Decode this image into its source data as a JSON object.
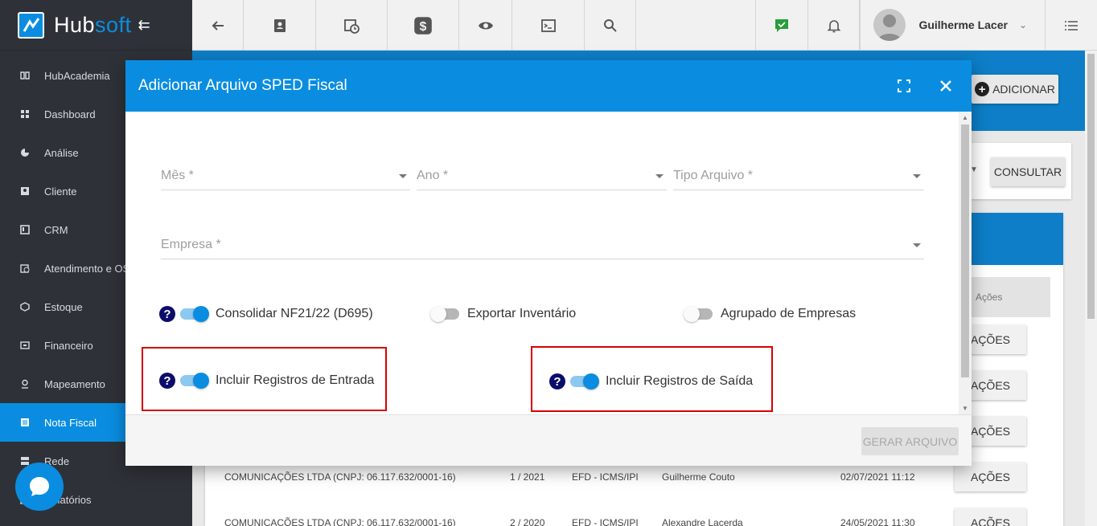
{
  "brand": {
    "name_a": "Hub",
    "name_b": "soft",
    "collapse_glyph": "⇇"
  },
  "sidebar": {
    "items": [
      {
        "label": "HubAcademia",
        "icon": "book-icon"
      },
      {
        "label": "Dashboard",
        "icon": "grid-icon"
      },
      {
        "label": "Análise",
        "icon": "pie-chart-icon"
      },
      {
        "label": "Cliente",
        "icon": "id-card-icon"
      },
      {
        "label": "CRM",
        "icon": "board-icon"
      },
      {
        "label": "Atendimento e OS",
        "icon": "clock-calendar-icon"
      },
      {
        "label": "Estoque",
        "icon": "box-icon"
      },
      {
        "label": "Financeiro",
        "icon": "money-icon"
      },
      {
        "label": "Mapeamento",
        "icon": "map-pin-icon"
      },
      {
        "label": "Nota Fiscal",
        "icon": "document-icon"
      },
      {
        "label": "Rede",
        "icon": "network-icon"
      },
      {
        "label": "Relatórios",
        "icon": "report-icon"
      }
    ],
    "active_index": 9
  },
  "topbar": {
    "user_name": "Guilherme Lacer",
    "icons": [
      "back-arrow-icon",
      "contact-card-icon",
      "calendar-clock-icon",
      "dollar-icon",
      "eye-icon",
      "terminal-icon",
      "search-icon",
      "chat-check-icon",
      "bell-icon",
      "list-icon"
    ]
  },
  "background": {
    "add_label": "ADICIONAR",
    "consultar_label": "CONSULTAR",
    "acoes_header": "Ações",
    "acoes_label": "AÇÕES",
    "rows": [
      {
        "empresa": "COMUNICAÇÕES LTDA (CNPJ: 06.117.632/0001-16)",
        "periodo": "1 / 2021",
        "tipo": "EFD - ICMS/IPI",
        "usuario": "Guilherme Couto",
        "data": "02/07/2021 11:12"
      },
      {
        "empresa": "COMUNICAÇÕES LTDA (CNPJ: 06.117.632/0001-16)",
        "periodo": "2 / 2020",
        "tipo": "EFD - ICMS/IPI",
        "usuario": "Alexandre Lacerda",
        "data": "24/05/2021 11:30"
      }
    ]
  },
  "dialog": {
    "title": "Adicionar Arquivo SPED Fiscal",
    "fields": {
      "mes": "Mês *",
      "ano": "Ano *",
      "tipo": "Tipo Arquivo *",
      "empresa": "Empresa *"
    },
    "toggles": {
      "consolidar": {
        "label": "Consolidar NF21/22 (D695)",
        "on": true
      },
      "inventario": {
        "label": "Exportar Inventário",
        "on": false
      },
      "agrupado": {
        "label": "Agrupado de Empresas",
        "on": false
      },
      "entrada": {
        "label": "Incluir Registros de Entrada",
        "on": true
      },
      "saida": {
        "label": "Incluir Registros de Saída",
        "on": true
      }
    },
    "help_glyph": "?",
    "gerar_label": "GERAR ARQUIVO"
  },
  "colors": {
    "primary": "#0a8de0",
    "sidebar": "#2e3238",
    "highlight": "#d80000",
    "help": "#0c0c6b"
  }
}
